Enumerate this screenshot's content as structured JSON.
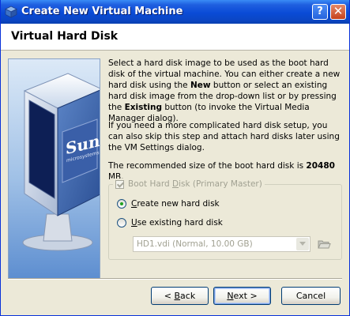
{
  "window": {
    "title": "Create New Virtual Machine",
    "help_button": "?",
    "close_button": "✕"
  },
  "header": {
    "title": "Virtual Hard Disk"
  },
  "side_image": {
    "logo_text": "Sun",
    "logo_subtext": "microsystems"
  },
  "description": {
    "p1_part1": "Select a hard disk image to be used as the boot hard disk of the virtual machine. You can either create a new hard disk using the ",
    "p1_new": "New",
    "p1_part2": " button or select an existing hard disk image from the drop-down list or by pressing the ",
    "p1_existing": "Existing",
    "p1_part3": " button (to invoke the Virtual Media Manager dialog).",
    "p2": "If you need a more complicated hard disk setup, you can also skip this step and attach hard disks later using the VM Settings dialog.",
    "p3_part1": "The recommended size of the boot hard disk is ",
    "p3_size": "20480",
    "p3_unit": " MB."
  },
  "boot_disk": {
    "checkbox_label_pre": "Boot Hard ",
    "checkbox_label_underlined": "D",
    "checkbox_label_post": "isk (Primary Master)",
    "checked": true,
    "create_new_u": "C",
    "create_new_rest": "reate new hard disk",
    "use_existing_u": "U",
    "use_existing_rest": "se existing hard disk",
    "selected_option": "create_new",
    "existing_disk_value": "HD1.vdi (Normal, 10.00 GB)"
  },
  "buttons": {
    "back_prefix": "< ",
    "back_u": "B",
    "back_rest": "ack",
    "next_u": "N",
    "next_rest": "ext >",
    "cancel": "Cancel"
  },
  "colors": {
    "titlebar": "#0a4bd6",
    "dialog_bg": "#ece9d8",
    "disabled_text": "#a1a192"
  }
}
